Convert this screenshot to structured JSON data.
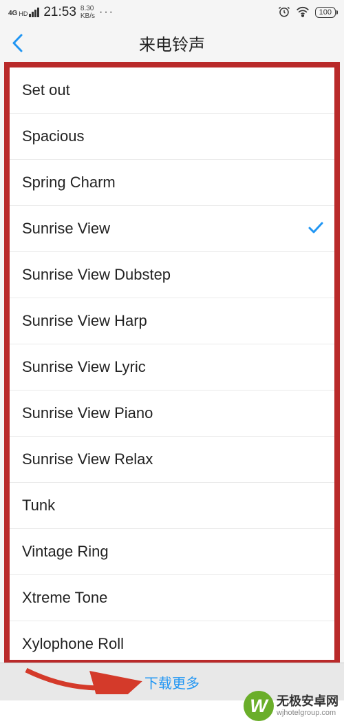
{
  "status_bar": {
    "network_type": "4G",
    "time": "21:53",
    "speed_top": "8.30",
    "speed_bot": "KB/s",
    "battery": "100"
  },
  "header": {
    "title": "来电铃声"
  },
  "ringtones": [
    {
      "label": "Set out",
      "selected": false
    },
    {
      "label": "Spacious",
      "selected": false
    },
    {
      "label": "Spring Charm",
      "selected": false
    },
    {
      "label": "Sunrise View",
      "selected": true
    },
    {
      "label": "Sunrise View Dubstep",
      "selected": false
    },
    {
      "label": "Sunrise View Harp",
      "selected": false
    },
    {
      "label": "Sunrise View Lyric",
      "selected": false
    },
    {
      "label": "Sunrise View Piano",
      "selected": false
    },
    {
      "label": "Sunrise View Relax",
      "selected": false
    },
    {
      "label": "Tunk",
      "selected": false
    },
    {
      "label": "Vintage Ring",
      "selected": false
    },
    {
      "label": "Xtreme Tone",
      "selected": false
    },
    {
      "label": "Xylophone Roll",
      "selected": false
    }
  ],
  "bottom": {
    "download_label": "下载更多"
  },
  "watermark": {
    "logo": "W",
    "cn": "无极安卓网",
    "url": "wjhotelgroup.com"
  }
}
